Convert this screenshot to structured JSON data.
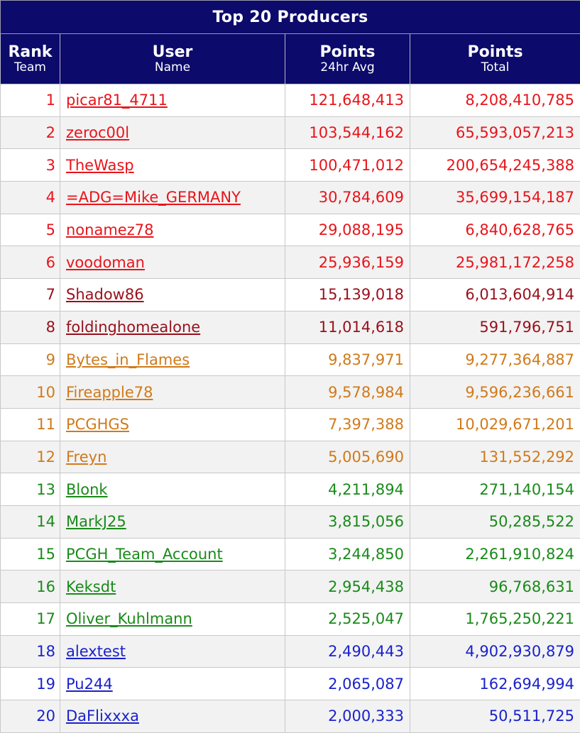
{
  "title": "Top 20 Producers",
  "columns": {
    "rank": {
      "main": "Rank",
      "sub": "Team"
    },
    "user": {
      "main": "User",
      "sub": "Name"
    },
    "avg": {
      "main": "Points",
      "sub": "24hr Avg"
    },
    "total": {
      "main": "Points",
      "sub": "Total"
    }
  },
  "colors": {
    "header_bg": "#0c0a6b",
    "tier_red": "#e8141a",
    "tier_darkred": "#98101b",
    "tier_orange": "#d07a1a",
    "tier_green": "#1a8a1a",
    "tier_blue": "#1a22cc"
  },
  "rows": [
    {
      "rank": "1",
      "user": "picar81_4711",
      "avg": "121,648,413",
      "total": "8,208,410,785",
      "color": "#e8141a"
    },
    {
      "rank": "2",
      "user": "zeroc00l",
      "avg": "103,544,162",
      "total": "65,593,057,213",
      "color": "#e8141a"
    },
    {
      "rank": "3",
      "user": "TheWasp",
      "avg": "100,471,012",
      "total": "200,654,245,388",
      "color": "#e8141a"
    },
    {
      "rank": "4",
      "user": "=ADG=Mike_GERMANY",
      "avg": "30,784,609",
      "total": "35,699,154,187",
      "color": "#e8141a"
    },
    {
      "rank": "5",
      "user": "nonamez78",
      "avg": "29,088,195",
      "total": "6,840,628,765",
      "color": "#e8141a"
    },
    {
      "rank": "6",
      "user": "voodoman",
      "avg": "25,936,159",
      "total": "25,981,172,258",
      "color": "#e8141a"
    },
    {
      "rank": "7",
      "user": "Shadow86",
      "avg": "15,139,018",
      "total": "6,013,604,914",
      "color": "#98101b"
    },
    {
      "rank": "8",
      "user": "foldinghomealone",
      "avg": "11,014,618",
      "total": "591,796,751",
      "color": "#98101b"
    },
    {
      "rank": "9",
      "user": "Bytes_in_Flames",
      "avg": "9,837,971",
      "total": "9,277,364,887",
      "color": "#d07a1a"
    },
    {
      "rank": "10",
      "user": "Fireapple78",
      "avg": "9,578,984",
      "total": "9,596,236,661",
      "color": "#d07a1a"
    },
    {
      "rank": "11",
      "user": "PCGHGS",
      "avg": "7,397,388",
      "total": "10,029,671,201",
      "color": "#d07a1a"
    },
    {
      "rank": "12",
      "user": "Freyn",
      "avg": "5,005,690",
      "total": "131,552,292",
      "color": "#d07a1a"
    },
    {
      "rank": "13",
      "user": "Blonk",
      "avg": "4,211,894",
      "total": "271,140,154",
      "color": "#1a8a1a"
    },
    {
      "rank": "14",
      "user": "MarkJ25",
      "avg": "3,815,056",
      "total": "50,285,522",
      "color": "#1a8a1a"
    },
    {
      "rank": "15",
      "user": "PCGH_Team_Account",
      "avg": "3,244,850",
      "total": "2,261,910,824",
      "color": "#1a8a1a"
    },
    {
      "rank": "16",
      "user": "Keksdt",
      "avg": "2,954,438",
      "total": "96,768,631",
      "color": "#1a8a1a"
    },
    {
      "rank": "17",
      "user": "Oliver_Kuhlmann",
      "avg": "2,525,047",
      "total": "1,765,250,221",
      "color": "#1a8a1a"
    },
    {
      "rank": "18",
      "user": "alextest",
      "avg": "2,490,443",
      "total": "4,902,930,879",
      "color": "#1a22cc"
    },
    {
      "rank": "19",
      "user": "Pu244",
      "avg": "2,065,087",
      "total": "162,694,994",
      "color": "#1a22cc"
    },
    {
      "rank": "20",
      "user": "DaFlixxxa",
      "avg": "2,000,333",
      "total": "50,511,725",
      "color": "#1a22cc"
    }
  ]
}
